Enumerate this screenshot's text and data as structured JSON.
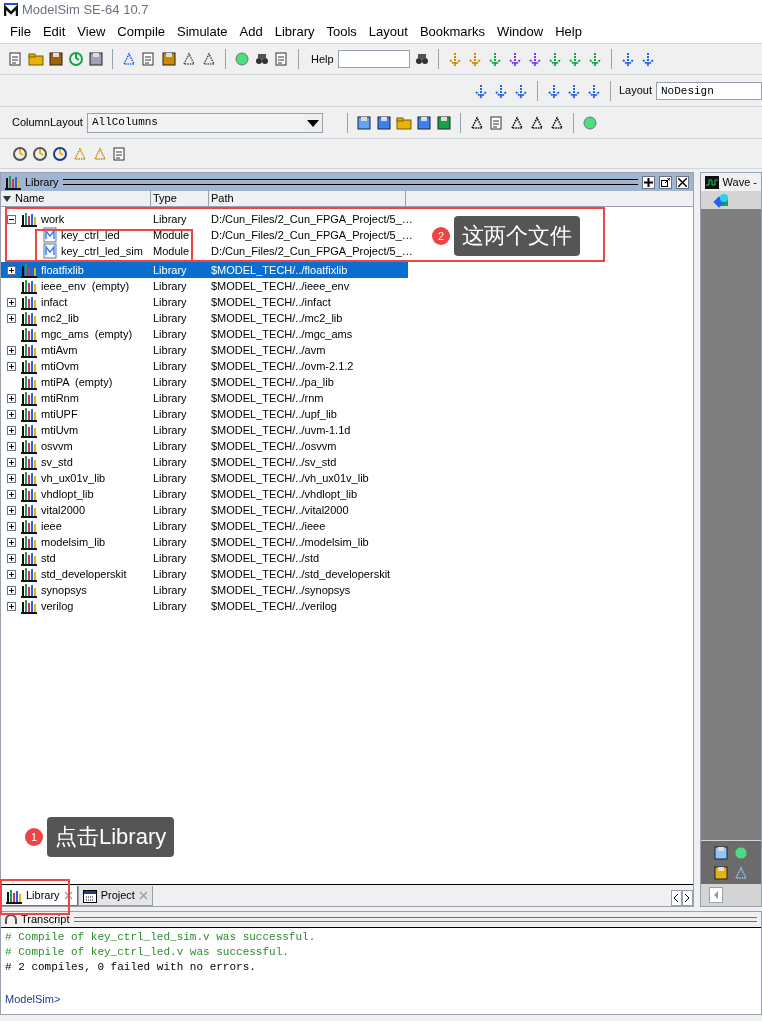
{
  "window": {
    "title": "ModelSim SE-64 10.7"
  },
  "menu": [
    "File",
    "Edit",
    "View",
    "Compile",
    "Simulate",
    "Add",
    "Library",
    "Tools",
    "Layout",
    "Bookmarks",
    "Window",
    "Help"
  ],
  "toolbar": {
    "help_label": "Help",
    "layout_label": "Layout",
    "layout_value": "NoDesign",
    "column_layout_label": "ColumnLayout",
    "column_layout_value": "AllColumns"
  },
  "library": {
    "title": "Library",
    "columns": [
      "Name",
      "Type",
      "Path"
    ],
    "rows": [
      {
        "name": "work",
        "type": "Library",
        "path": "D:/Cun_Files/2_Cun_FPGA_Project/5_…",
        "expandable": true,
        "expanded": true,
        "selected": false,
        "children": [
          {
            "name": "key_ctrl_led",
            "type": "Module",
            "path": "D:/Cun_Files/2_Cun_FPGA_Project/5_…",
            "expandable": false,
            "selected": false
          },
          {
            "name": "key_ctrl_led_sim",
            "type": "Module",
            "path": "D:/Cun_Files/2_Cun_FPGA_Project/5_…",
            "expandable": false,
            "selected": false
          }
        ]
      },
      {
        "name": "floatfixlib",
        "type": "Library",
        "path": "$MODEL_TECH/../floatfixlib",
        "expandable": true,
        "expanded": false,
        "selected": true
      },
      {
        "name": "ieee_env  (empty)",
        "type": "Library",
        "path": "$MODEL_TECH/../ieee_env",
        "expandable": false,
        "selected": false
      },
      {
        "name": "infact",
        "type": "Library",
        "path": "$MODEL_TECH/../infact",
        "expandable": true,
        "expanded": false,
        "selected": false
      },
      {
        "name": "mc2_lib",
        "type": "Library",
        "path": "$MODEL_TECH/../mc2_lib",
        "expandable": true,
        "expanded": false,
        "selected": false
      },
      {
        "name": "mgc_ams  (empty)",
        "type": "Library",
        "path": "$MODEL_TECH/../mgc_ams",
        "expandable": false,
        "selected": false
      },
      {
        "name": "mtiAvm",
        "type": "Library",
        "path": "$MODEL_TECH/../avm",
        "expandable": true,
        "expanded": false,
        "selected": false
      },
      {
        "name": "mtiOvm",
        "type": "Library",
        "path": "$MODEL_TECH/../ovm-2.1.2",
        "expandable": true,
        "expanded": false,
        "selected": false
      },
      {
        "name": "mtiPA  (empty)",
        "type": "Library",
        "path": "$MODEL_TECH/../pa_lib",
        "expandable": false,
        "selected": false
      },
      {
        "name": "mtiRnm",
        "type": "Library",
        "path": "$MODEL_TECH/../rnm",
        "expandable": true,
        "expanded": false,
        "selected": false
      },
      {
        "name": "mtiUPF",
        "type": "Library",
        "path": "$MODEL_TECH/../upf_lib",
        "expandable": true,
        "expanded": false,
        "selected": false
      },
      {
        "name": "mtiUvm",
        "type": "Library",
        "path": "$MODEL_TECH/../uvm-1.1d",
        "expandable": true,
        "expanded": false,
        "selected": false
      },
      {
        "name": "osvvm",
        "type": "Library",
        "path": "$MODEL_TECH/../osvvm",
        "expandable": true,
        "expanded": false,
        "selected": false
      },
      {
        "name": "sv_std",
        "type": "Library",
        "path": "$MODEL_TECH/../sv_std",
        "expandable": true,
        "expanded": false,
        "selected": false
      },
      {
        "name": "vh_ux01v_lib",
        "type": "Library",
        "path": "$MODEL_TECH/../vh_ux01v_lib",
        "expandable": true,
        "expanded": false,
        "selected": false
      },
      {
        "name": "vhdlopt_lib",
        "type": "Library",
        "path": "$MODEL_TECH/../vhdlopt_lib",
        "expandable": true,
        "expanded": false,
        "selected": false
      },
      {
        "name": "vital2000",
        "type": "Library",
        "path": "$MODEL_TECH/../vital2000",
        "expandable": true,
        "expanded": false,
        "selected": false
      },
      {
        "name": "ieee",
        "type": "Library",
        "path": "$MODEL_TECH/../ieee",
        "expandable": true,
        "expanded": false,
        "selected": false
      },
      {
        "name": "modelsim_lib",
        "type": "Library",
        "path": "$MODEL_TECH/../modelsim_lib",
        "expandable": true,
        "expanded": false,
        "selected": false
      },
      {
        "name": "std",
        "type": "Library",
        "path": "$MODEL_TECH/../std",
        "expandable": true,
        "expanded": false,
        "selected": false
      },
      {
        "name": "std_developerskit",
        "type": "Library",
        "path": "$MODEL_TECH/../std_developerskit",
        "expandable": true,
        "expanded": false,
        "selected": false
      },
      {
        "name": "synopsys",
        "type": "Library",
        "path": "$MODEL_TECH/../synopsys",
        "expandable": true,
        "expanded": false,
        "selected": false
      },
      {
        "name": "verilog",
        "type": "Library",
        "path": "$MODEL_TECH/../verilog",
        "expandable": true,
        "expanded": false,
        "selected": false
      }
    ]
  },
  "tabs": [
    {
      "label": "Library",
      "kind": "library",
      "selected": true
    },
    {
      "label": "Project",
      "kind": "project",
      "selected": false
    }
  ],
  "wave": {
    "title": "Wave -"
  },
  "transcript": {
    "title": "Transcript",
    "lines": [
      {
        "text": "# Compile of key_ctrl_led_sim.v was successful.",
        "kind": "success"
      },
      {
        "text": "# Compile of key_ctrl_led.v was successful.",
        "kind": "success"
      },
      {
        "text": "# 2 compiles, 0 failed with no errors.",
        "kind": "plain"
      }
    ],
    "prompt": "ModelSim>"
  },
  "annotations": [
    {
      "number": "2",
      "text": "这两个文件"
    },
    {
      "number": "1",
      "text": "点击Library"
    }
  ]
}
